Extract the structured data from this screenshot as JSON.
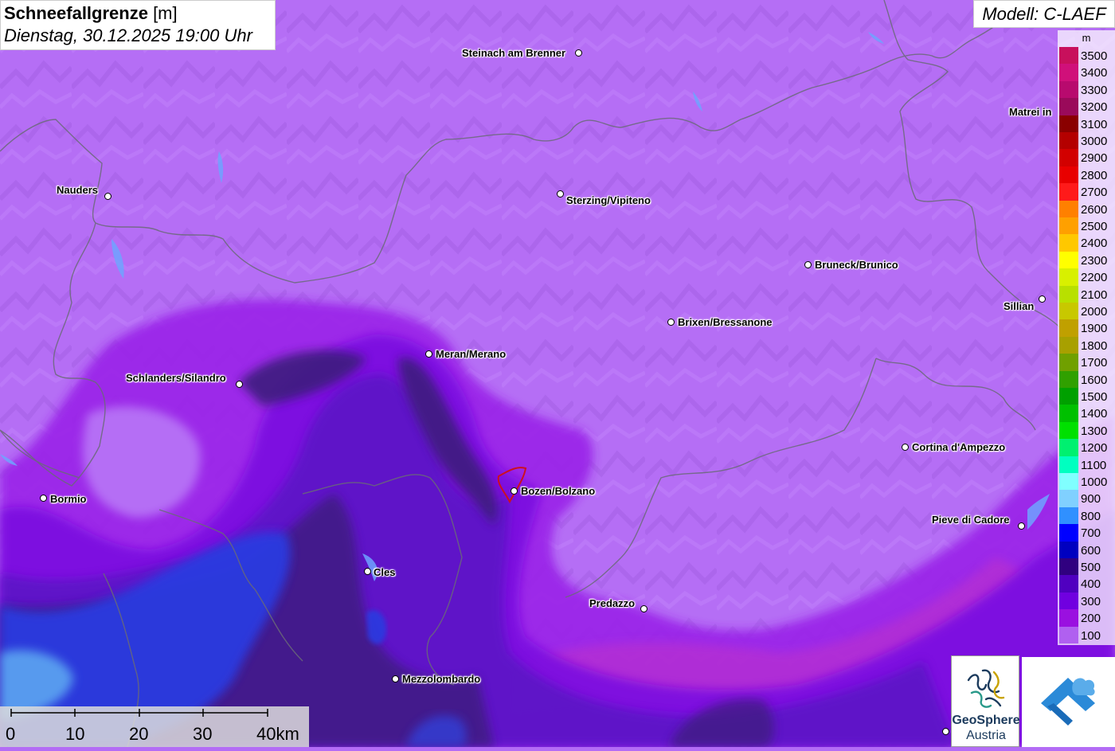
{
  "header": {
    "title_bold": "Schneefallgrenze",
    "title_unit": " [m]",
    "datetime": "Dienstag, 30.12.2025 19:00 Uhr"
  },
  "model": {
    "label": "Modell: C-LAEF"
  },
  "legend": {
    "unit": "m",
    "items": [
      {
        "label": "3500",
        "color": "#c8105c"
      },
      {
        "label": "3400",
        "color": "#d0107a"
      },
      {
        "label": "3300",
        "color": "#b80a6e"
      },
      {
        "label": "3200",
        "color": "#9a0a5a"
      },
      {
        "label": "3100",
        "color": "#8a0000"
      },
      {
        "label": "3000",
        "color": "#b40000"
      },
      {
        "label": "2900",
        "color": "#d20000"
      },
      {
        "label": "2800",
        "color": "#e80000"
      },
      {
        "label": "2700",
        "color": "#ff1a1a"
      },
      {
        "label": "2600",
        "color": "#ff8000"
      },
      {
        "label": "2500",
        "color": "#ffa000"
      },
      {
        "label": "2400",
        "color": "#ffc800"
      },
      {
        "label": "2300",
        "color": "#ffff00"
      },
      {
        "label": "2200",
        "color": "#d8f000"
      },
      {
        "label": "2100",
        "color": "#b8e000"
      },
      {
        "label": "2000",
        "color": "#c8c800"
      },
      {
        "label": "1900",
        "color": "#c0a000"
      },
      {
        "label": "1800",
        "color": "#a8a000"
      },
      {
        "label": "1700",
        "color": "#70a000"
      },
      {
        "label": "1600",
        "color": "#30a000"
      },
      {
        "label": "1500",
        "color": "#00a000"
      },
      {
        "label": "1400",
        "color": "#00c000"
      },
      {
        "label": "1300",
        "color": "#00e000"
      },
      {
        "label": "1200",
        "color": "#00f070"
      },
      {
        "label": "1100",
        "color": "#00ffc0"
      },
      {
        "label": "1000",
        "color": "#80ffff"
      },
      {
        "label": "900",
        "color": "#80d0ff"
      },
      {
        "label": "800",
        "color": "#3090ff"
      },
      {
        "label": "700",
        "color": "#0000ff"
      },
      {
        "label": "600",
        "color": "#0000c0"
      },
      {
        "label": "500",
        "color": "#300080"
      },
      {
        "label": "400",
        "color": "#5000c0"
      },
      {
        "label": "300",
        "color": "#7000e0"
      },
      {
        "label": "200",
        "color": "#9a10e0"
      },
      {
        "label": "100",
        "color": "#b060f0"
      }
    ]
  },
  "cities": [
    {
      "name": "Steinach am Brenner"
    },
    {
      "name": "Nauders"
    },
    {
      "name": "Sterzing/Vipiteno"
    },
    {
      "name": "Matrei in"
    },
    {
      "name": "Bruneck/Brunico"
    },
    {
      "name": "Sillian"
    },
    {
      "name": "Brixen/Bressanone"
    },
    {
      "name": "Meran/Merano"
    },
    {
      "name": "Schlanders/Silandro"
    },
    {
      "name": "Cortina d'Ampezzo"
    },
    {
      "name": "Bormio"
    },
    {
      "name": "Bozen/Bolzano"
    },
    {
      "name": "Pieve di Cadore"
    },
    {
      "name": "Cles"
    },
    {
      "name": "Predazzo"
    },
    {
      "name": "Mezzolombardo"
    }
  ],
  "scale": {
    "labels": [
      "0",
      "10",
      "20",
      "30",
      "40km"
    ]
  },
  "logo": {
    "line1": "GeoSphere",
    "line2": "Austria"
  }
}
